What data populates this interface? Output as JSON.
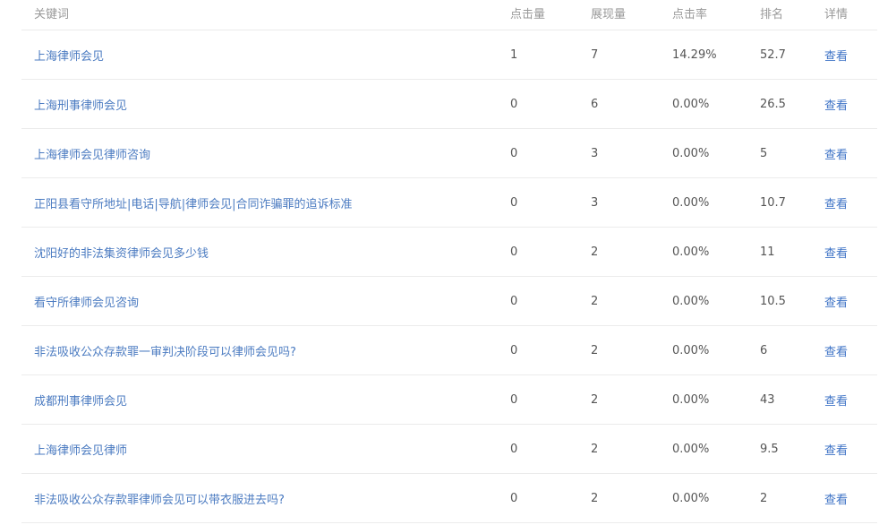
{
  "header": {
    "keyword": "关键词",
    "clicks": "点击量",
    "impressions": "展现量",
    "ctr": "点击率",
    "rank": "排名",
    "detail": "详情"
  },
  "rows": [
    {
      "keyword": "上海律师会见",
      "clicks": "1",
      "impressions": "7",
      "ctr": "14.29%",
      "rank": "52.7",
      "detail": "查看"
    },
    {
      "keyword": "上海刑事律师会见",
      "clicks": "0",
      "impressions": "6",
      "ctr": "0.00%",
      "rank": "26.5",
      "detail": "查看"
    },
    {
      "keyword": "上海律师会见律师咨询",
      "clicks": "0",
      "impressions": "3",
      "ctr": "0.00%",
      "rank": "5",
      "detail": "查看"
    },
    {
      "keyword": "正阳县看守所地址|电话|导航|律师会见|合同诈骗罪的追诉标准",
      "clicks": "0",
      "impressions": "3",
      "ctr": "0.00%",
      "rank": "10.7",
      "detail": "查看"
    },
    {
      "keyword": "沈阳好的非法集资律师会见多少钱",
      "clicks": "0",
      "impressions": "2",
      "ctr": "0.00%",
      "rank": "11",
      "detail": "查看"
    },
    {
      "keyword": "看守所律师会见咨询",
      "clicks": "0",
      "impressions": "2",
      "ctr": "0.00%",
      "rank": "10.5",
      "detail": "查看"
    },
    {
      "keyword": "非法吸收公众存款罪一审判决阶段可以律师会见吗?",
      "clicks": "0",
      "impressions": "2",
      "ctr": "0.00%",
      "rank": "6",
      "detail": "查看"
    },
    {
      "keyword": "成都刑事律师会见",
      "clicks": "0",
      "impressions": "2",
      "ctr": "0.00%",
      "rank": "43",
      "detail": "查看"
    },
    {
      "keyword": "上海律师会见律师",
      "clicks": "0",
      "impressions": "2",
      "ctr": "0.00%",
      "rank": "9.5",
      "detail": "查看"
    },
    {
      "keyword": "非法吸收公众存款罪律师会见可以带衣服进去吗?",
      "clicks": "0",
      "impressions": "2",
      "ctr": "0.00%",
      "rank": "2",
      "detail": "查看"
    }
  ]
}
